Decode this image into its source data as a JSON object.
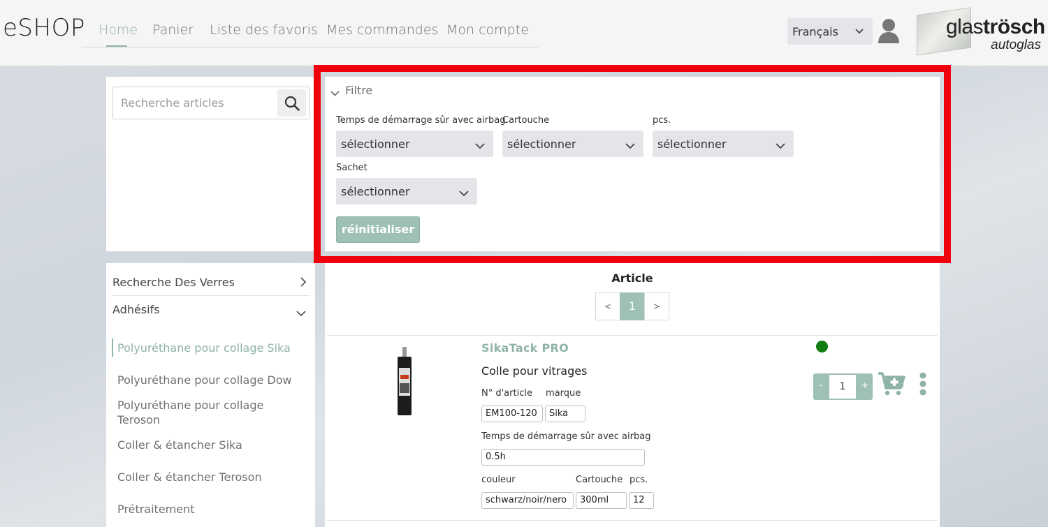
{
  "brand": "eSHOP",
  "nav": {
    "items": [
      {
        "label": "Home",
        "active": true
      },
      {
        "label": "Panier",
        "active": false
      },
      {
        "label": "Liste des favoris",
        "active": false
      },
      {
        "label": "Mes commandes",
        "active": false
      },
      {
        "label": "Mon compte",
        "active": false
      }
    ]
  },
  "language": {
    "selected": "Français"
  },
  "logo": {
    "text_light": "glas",
    "text_bold": "trösch",
    "sub": "autoglas"
  },
  "search": {
    "placeholder": "Recherche articles",
    "icon": "search-icon"
  },
  "filter": {
    "toggle_label": "Filtre",
    "fields": [
      {
        "label": "Temps de démarrage sûr avec airbag",
        "value": "sélectionner"
      },
      {
        "label": "Cartouche",
        "value": "sélectionner"
      },
      {
        "label": "pcs.",
        "value": "sélectionner"
      },
      {
        "label": "Sachet",
        "value": "sélectionner"
      }
    ],
    "reset_label": "réinitialiser"
  },
  "categories": {
    "sections": [
      {
        "label": "Recherche Des Verres",
        "expanded": false
      },
      {
        "label": "Adhésifs",
        "expanded": true
      }
    ],
    "items": [
      {
        "label": "Polyuréthane pour collage Sika",
        "active": true
      },
      {
        "label": "Polyuréthane pour collage Dow",
        "active": false
      },
      {
        "label": "Polyuréthane pour collage Teroson",
        "active": false
      },
      {
        "label": "Coller & étancher Sika",
        "active": false
      },
      {
        "label": "Coller & étancher Teroson",
        "active": false
      },
      {
        "label": "Prétraitement",
        "active": false
      }
    ]
  },
  "articles": {
    "title": "Article",
    "pager": {
      "prev": "<",
      "current": "1",
      "next": ">"
    },
    "product": {
      "name": "SikaTack PRO",
      "description": "Colle pour vitrages",
      "labels": {
        "article_no": "N° d'article",
        "brand": "marque",
        "airbag_time": "Temps de démarrage sûr avec airbag",
        "color": "couleur",
        "cartridge": "Cartouche",
        "pcs": "pcs."
      },
      "values": {
        "article_no": "EM100-120",
        "brand": "Sika",
        "airbag_time": "0.5h",
        "color": "schwarz/noir/nero",
        "cartridge": "300ml",
        "pcs": "12"
      },
      "availability_color": "#0f7d0f",
      "quantity": {
        "minus": "-",
        "value": "1",
        "plus": "+"
      }
    }
  },
  "colors": {
    "accent": "#8fb3a6",
    "button": "#9ec1b4",
    "highlight_frame": "#f0000a"
  }
}
